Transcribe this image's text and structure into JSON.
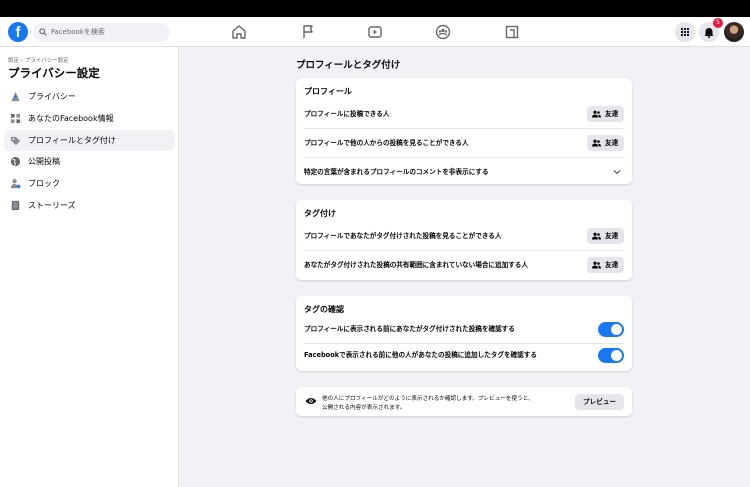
{
  "topbar": {
    "search_placeholder": "Facebookを検索",
    "notification_count": "5",
    "logo": "f"
  },
  "sidebar": {
    "breadcrumb": "設定 › プライバシー設定",
    "title": "プライバシー設定",
    "items": [
      {
        "label": "プライバシー",
        "icon": "lock-icon"
      },
      {
        "label": "あなたのFacebook情報",
        "icon": "grid-icon"
      },
      {
        "label": "プロフィールとタグ付け",
        "icon": "tag-icon",
        "active": true
      },
      {
        "label": "公開投稿",
        "icon": "globe-icon"
      },
      {
        "label": "ブロック",
        "icon": "block-user-icon"
      },
      {
        "label": "ストーリーズ",
        "icon": "book-icon"
      }
    ]
  },
  "main": {
    "title": "プロフィールとタグ付け",
    "profile_section": {
      "title": "プロフィール",
      "rows": [
        {
          "label": "プロフィールに投稿できる人",
          "value": "友達"
        },
        {
          "label": "プロフィールで他の人からの投稿を見ることができる人",
          "value": "友達"
        },
        {
          "label": "特定の言葉が含まれるプロフィールのコメントを非表示にする"
        }
      ]
    },
    "tagging_section": {
      "title": "タグ付け",
      "rows": [
        {
          "label": "プロフィールであなたがタグ付けされた投稿を見ることができる人",
          "value": "友達"
        },
        {
          "label": "あなたがタグ付けされた投稿の共有範囲に含まれていない場合に追加する人",
          "value": "友達"
        }
      ]
    },
    "review_section": {
      "title": "タグの確認",
      "rows": [
        {
          "label": "プロフィールに表示される前にあなたがタグ付けされた投稿を確認する",
          "enabled": true
        },
        {
          "label": "Facebookで表示される前に他の人があなたの投稿に追加したタグを確認する",
          "enabled": true
        }
      ]
    },
    "preview": {
      "text_line1": "他の人にプロフィールがどのように表示されるか確認します。プレビューを使うと、",
      "text_line2": "公開される内容が表示されます。",
      "button": "プレビュー"
    }
  },
  "colors": {
    "accent": "#1877f2",
    "background": "#f0f2f5",
    "button_gray": "#e4e6eb",
    "badge": "#e41e3f"
  }
}
